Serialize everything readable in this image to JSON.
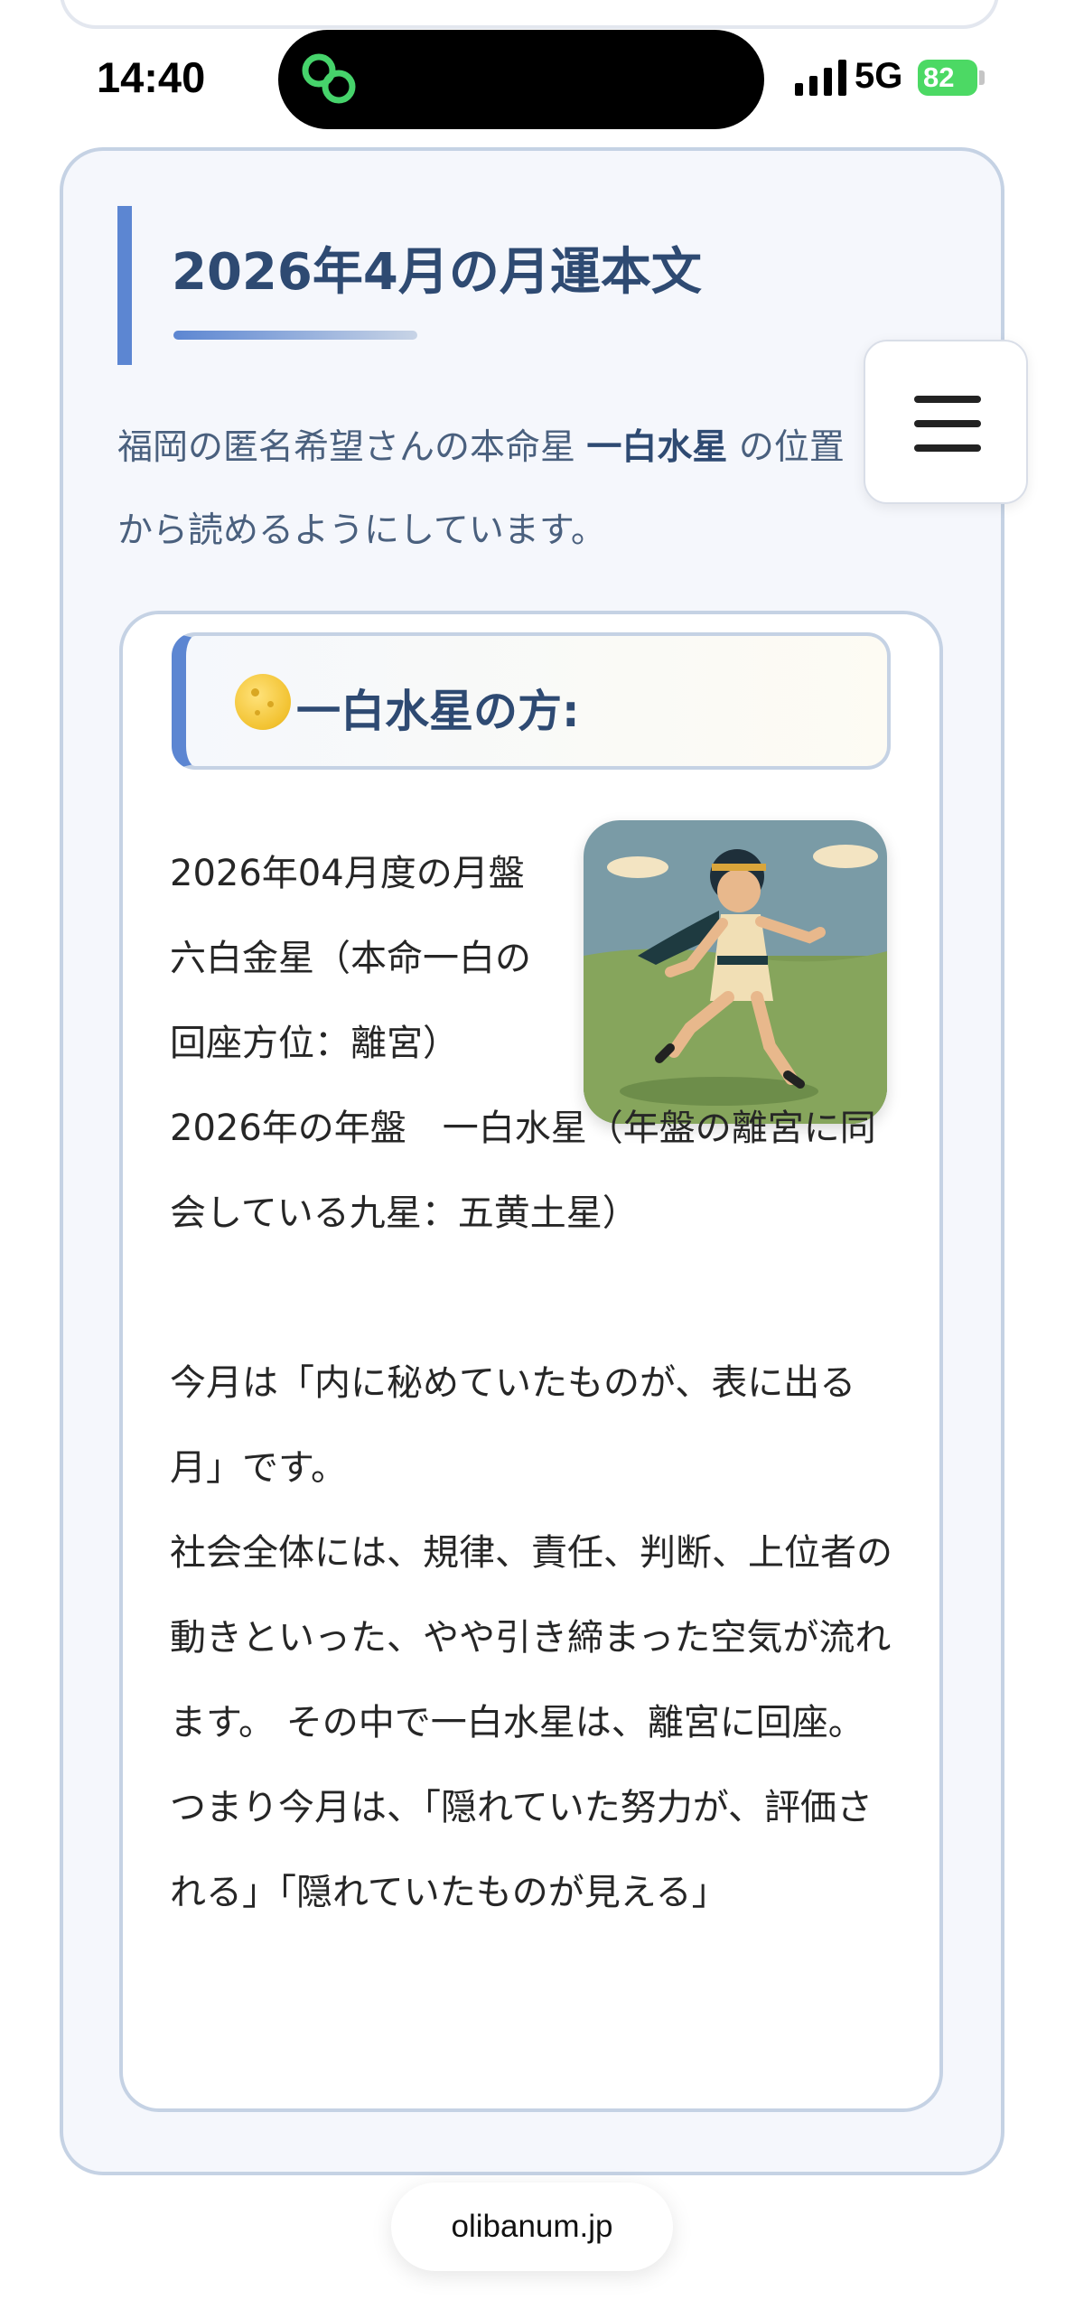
{
  "status_bar": {
    "time": "14:40",
    "network": "5G",
    "battery": "82"
  },
  "article": {
    "title": "2026年4月の月運本文",
    "intro_prefix": "福岡の匿名希望さんの本命星 ",
    "intro_star": "一白水星",
    "intro_suffix": " の位置から読めるようにしています。"
  },
  "content": {
    "heading": "一白水星の方:",
    "heading_icon": "full-moon-icon",
    "paragraphs": [
      "2026年04月度の月盤　六白金星（本命一白の回座方位：離宮）",
      "2026年の年盤　一白水星（年盤の離宮に同会している九星：五黄土星）",
      "",
      "今月は「内に秘めていたものが、表に出る月」です。",
      "社会全体には、規律、責任、判断、上位者の動きといった、やや引き締まった空気が流れます。 その中で一白水星は、離宮に回座。",
      "つまり今月は、「隠れていた努力が、評価される」「隠れていたものが見える」"
    ]
  },
  "footer": {
    "domain": "olibanum.jp"
  },
  "colors": {
    "accent": "#5c86d2",
    "title": "#2e4a72",
    "card_bg": "#f5f7fc",
    "card_border": "#c5d2e4"
  }
}
